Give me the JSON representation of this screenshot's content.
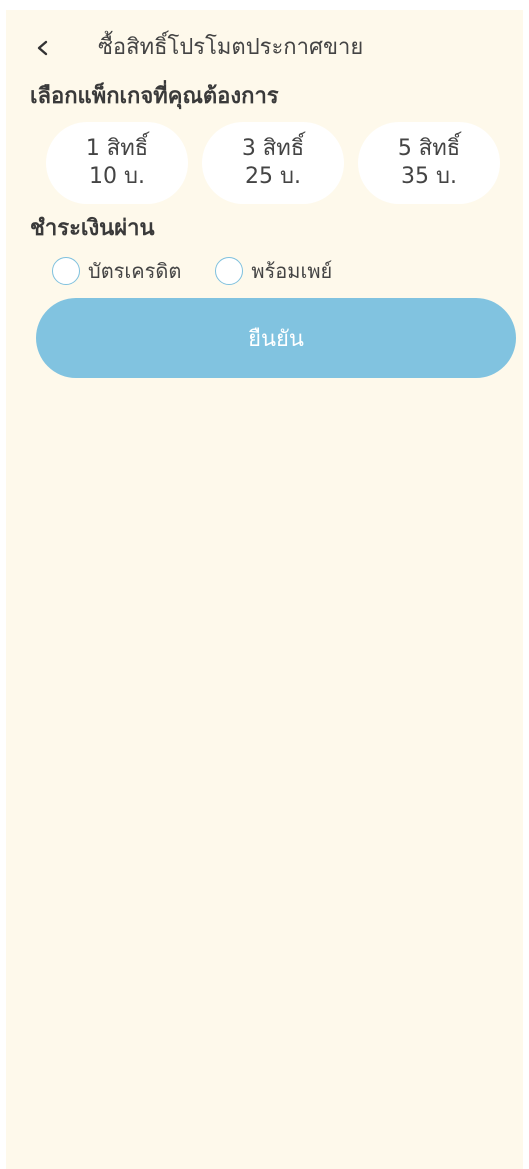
{
  "header": {
    "back_icon": "chevron-left-icon",
    "title": "ซื้อสิทธิ์โปรโมตประกาศขาย"
  },
  "package_section": {
    "title": "เลือกแพ็กเกจที่คุณต้องการ",
    "packages": [
      {
        "rights": "1 สิทธิ์",
        "price": "10 บ."
      },
      {
        "rights": "3 สิทธิ์",
        "price": "25 บ."
      },
      {
        "rights": "5 สิทธิ์",
        "price": "35 บ."
      }
    ]
  },
  "payment_section": {
    "title": "ชำระเงินผ่าน",
    "options": [
      {
        "label": "บัตรเครดิต",
        "selected": false
      },
      {
        "label": "พร้อมเพย์",
        "selected": false
      }
    ]
  },
  "confirm_button": {
    "label": "ยืนยัน"
  },
  "colors": {
    "background": "#FEF9EB",
    "card": "#FFFFFF",
    "accent": "#81C3E0",
    "radio_border": "#7FC1DE",
    "text": "#444444"
  }
}
